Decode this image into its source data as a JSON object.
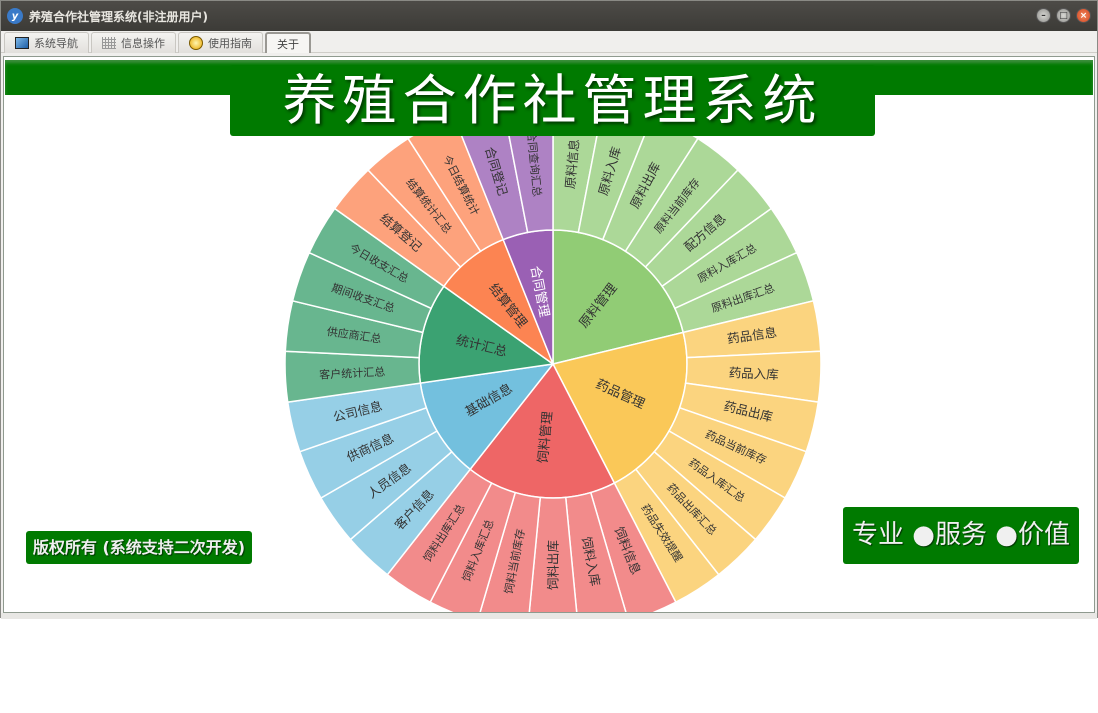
{
  "window": {
    "title": "养殖合作社管理系统(非注册用户)",
    "app_icon": "yf-logo-icon"
  },
  "tabs": [
    {
      "label": "系统导航",
      "icon": "monitor-icon"
    },
    {
      "label": "信息操作",
      "icon": "grid-icon"
    },
    {
      "label": "使用指南",
      "icon": "help-icon"
    },
    {
      "label": "关于",
      "icon": ""
    }
  ],
  "header": {
    "title": "养殖合作社管理系统"
  },
  "footer": {
    "copyright": "版权所有 (系统支持二次开发)",
    "slogan": "专业 ●服务 ●价值"
  },
  "chart_data": {
    "type": "sunburst",
    "start": "top-clockwise",
    "groups": [
      {
        "name": "原料管理",
        "color": "#91cc75",
        "light": "#acd898",
        "children": [
          "原料信息",
          "原料入库",
          "原料出库",
          "原料当前库存",
          "配方信息",
          "原料入库汇总",
          "原料出库汇总"
        ]
      },
      {
        "name": "药品管理",
        "color": "#fac858",
        "light": "#fbd47f",
        "children": [
          "药品信息",
          "药品入库",
          "药品出库",
          "药品当前库存",
          "药品入库汇总",
          "药品出库汇总",
          "药品失效提醒"
        ]
      },
      {
        "name": "饲料管理",
        "color": "#ee6666",
        "light": "#f28b8b",
        "children": [
          "饲料信息",
          "饲料入库",
          "饲料出库",
          "饲料当前库存",
          "饲料入库汇总",
          "饲料出库汇总"
        ]
      },
      {
        "name": "基础信息",
        "color": "#73c0de",
        "light": "#96cfe6",
        "children": [
          "客户信息",
          "人员信息",
          "供商信息",
          "公司信息"
        ]
      },
      {
        "name": "统计汇总",
        "color": "#3ba272",
        "light": "#68b68f",
        "children": [
          "客户统计汇总",
          "供应商汇总",
          "期间收支汇总",
          "今日收支汇总"
        ]
      },
      {
        "name": "结算管理",
        "color": "#fc8452",
        "light": "#fda27c",
        "children": [
          "结算登记",
          "结算统计汇总",
          "今日结算统计"
        ]
      },
      {
        "name": "合同管理",
        "color": "#9a60b4",
        "light": "#ae82c4",
        "children": [
          "合同登记",
          "合同查询汇总"
        ]
      }
    ]
  }
}
